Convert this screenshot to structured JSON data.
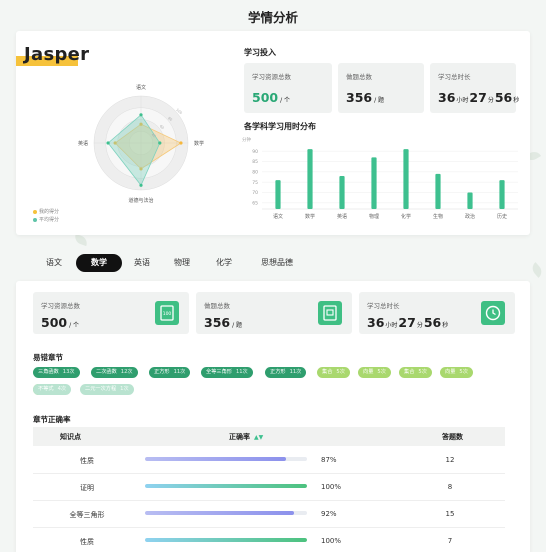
{
  "page_title": "学情分析",
  "student": {
    "name": "Jasper"
  },
  "radar": {
    "axes": [
      "语文",
      "数学",
      "道德与法治",
      "英语"
    ],
    "series": [
      {
        "name": "我的得分",
        "color": "#f5c97a",
        "values": [
          0.4,
          0.85,
          0.55,
          0.55
        ]
      },
      {
        "name": "平均得分",
        "color": "#7fd2bf",
        "values": [
          0.6,
          0.4,
          0.9,
          0.7
        ]
      }
    ],
    "scale_labels": [
      "40",
      "60",
      "80",
      "100"
    ],
    "legend": [
      "我的得分",
      "平均得分"
    ]
  },
  "investment": {
    "title": "学习投入",
    "stats": [
      {
        "label": "学习资源总数",
        "value": "500",
        "unit": "/ 个"
      },
      {
        "label": "做题总数",
        "value": "356",
        "unit": "/ 题"
      },
      {
        "label": "学习总时长",
        "h": "36",
        "h_unit": "小时",
        "m": "27",
        "m_unit": "分",
        "s": "56",
        "s_unit": "秒"
      }
    ]
  },
  "chart_data": {
    "type": "bar",
    "title": "各学科学习用时分布",
    "ylabel": "分钟",
    "categories": [
      "语文",
      "数学",
      "英语",
      "物理",
      "化学",
      "生物",
      "政治",
      "历史"
    ],
    "values": [
      76,
      91,
      78,
      87,
      91,
      79,
      70,
      76
    ],
    "yticks": [
      65,
      70,
      75,
      80,
      85,
      90
    ],
    "ylim": [
      62,
      93
    ],
    "color": "#3ec08f"
  },
  "subject_tabs": {
    "items": [
      "语文",
      "数学",
      "英语",
      "物理",
      "化学",
      "思想品德"
    ],
    "active": 1
  },
  "subject_stats": [
    {
      "label": "学习资源总数",
      "value": "500",
      "unit": "/ 个",
      "icon": "book-icon"
    },
    {
      "label": "做题总数",
      "value": "356",
      "unit": "/ 题",
      "icon": "exercise-icon"
    },
    {
      "label": "学习总时长",
      "h": "36",
      "h_unit": "小时",
      "m": "27",
      "m_unit": "分",
      "s": "56",
      "s_unit": "秒",
      "icon": "clock-icon"
    }
  ],
  "mistakes": {
    "title": "易错章节",
    "chips": [
      {
        "name": "三角函数",
        "count": "13次",
        "color": "#2f9e6e"
      },
      {
        "name": "二次函数",
        "count": "12次",
        "color": "#2f9e6e"
      },
      {
        "name": "正方形",
        "count": "11次",
        "color": "#2f9e6e"
      },
      {
        "name": "全等三角形",
        "count": "11次",
        "color": "#2f9e6e"
      },
      {
        "name": "正方形",
        "count": "11次",
        "color": "#2f9e6e"
      },
      {
        "name": "集合",
        "count": "5次",
        "color": "#a9d86e"
      },
      {
        "name": "向量",
        "count": "5次",
        "color": "#a9d86e"
      },
      {
        "name": "集合",
        "count": "5次",
        "color": "#a9d86e"
      },
      {
        "name": "向量",
        "count": "5次",
        "color": "#a9d86e"
      },
      {
        "name": "向量",
        "count": "5次",
        "color": "#a9d86e"
      },
      {
        "name": "不等式",
        "count": "4次",
        "color": "#b9e3d0"
      },
      {
        "name": "二元一次方程",
        "count": "1次",
        "color": "#b9e3d0"
      }
    ]
  },
  "accuracy": {
    "title": "章节正确率",
    "headers": [
      "知识点",
      "正确率",
      "答题数"
    ],
    "rows": [
      {
        "topic": "性质",
        "rate": 87,
        "rate_text": "87%",
        "count": "12",
        "color": "#a3a7ef"
      },
      {
        "topic": "证明",
        "rate": 100,
        "rate_text": "100%",
        "count": "8",
        "color": "#5fc48d"
      },
      {
        "topic": "全等三角形",
        "rate": 92,
        "rate_text": "92%",
        "count": "15",
        "color": "#9c9ff0"
      },
      {
        "topic": "性质",
        "rate": 100,
        "rate_text": "100%",
        "count": "7",
        "color": "#5fc48d"
      }
    ]
  }
}
